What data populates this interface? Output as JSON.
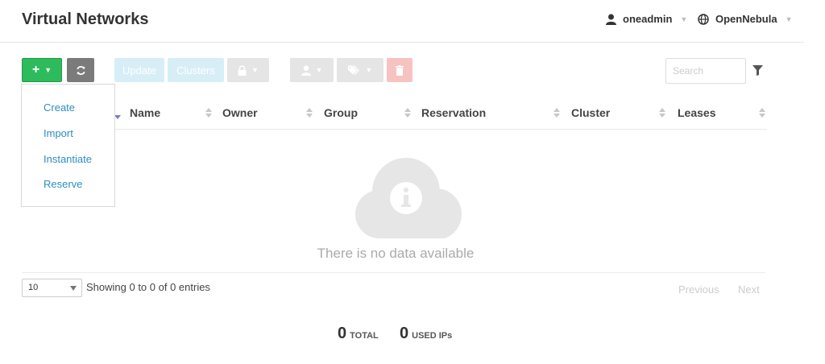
{
  "header": {
    "title": "Virtual Networks",
    "user": "oneadmin",
    "zone": "OpenNebula"
  },
  "toolbar": {
    "create_icon": "plus-icon",
    "refresh_icon": "refresh-icon",
    "update_label": "Update",
    "clusters_label": "Clusters",
    "lock_icon": "lock-icon",
    "user_icon": "user-icon",
    "tag_icon": "tag-icon",
    "delete_icon": "trash-icon",
    "search_placeholder": "Search",
    "filter_icon": "filter-icon"
  },
  "create_menu": {
    "items": [
      "Create",
      "Import",
      "Instantiate",
      "Reserve"
    ]
  },
  "table": {
    "columns": [
      "Name",
      "Owner",
      "Group",
      "Reservation",
      "Cluster",
      "Leases"
    ],
    "empty_icon": "cloud-info-icon",
    "empty_text": "There is no data available"
  },
  "footer": {
    "page_size": "10",
    "entries_info": "Showing 0 to 0 of 0 entries",
    "prev_label": "Previous",
    "next_label": "Next"
  },
  "stats": {
    "total_value": "0",
    "total_label": "TOTAL",
    "used_value": "0",
    "used_label": "USED IPs"
  },
  "colors": {
    "create_button": "#2dbb5c",
    "refresh_button": "#7b7b7b",
    "link": "#2d8ec2",
    "disabled_info": "#d7eef7",
    "disabled_danger": "#f6c3c1"
  }
}
